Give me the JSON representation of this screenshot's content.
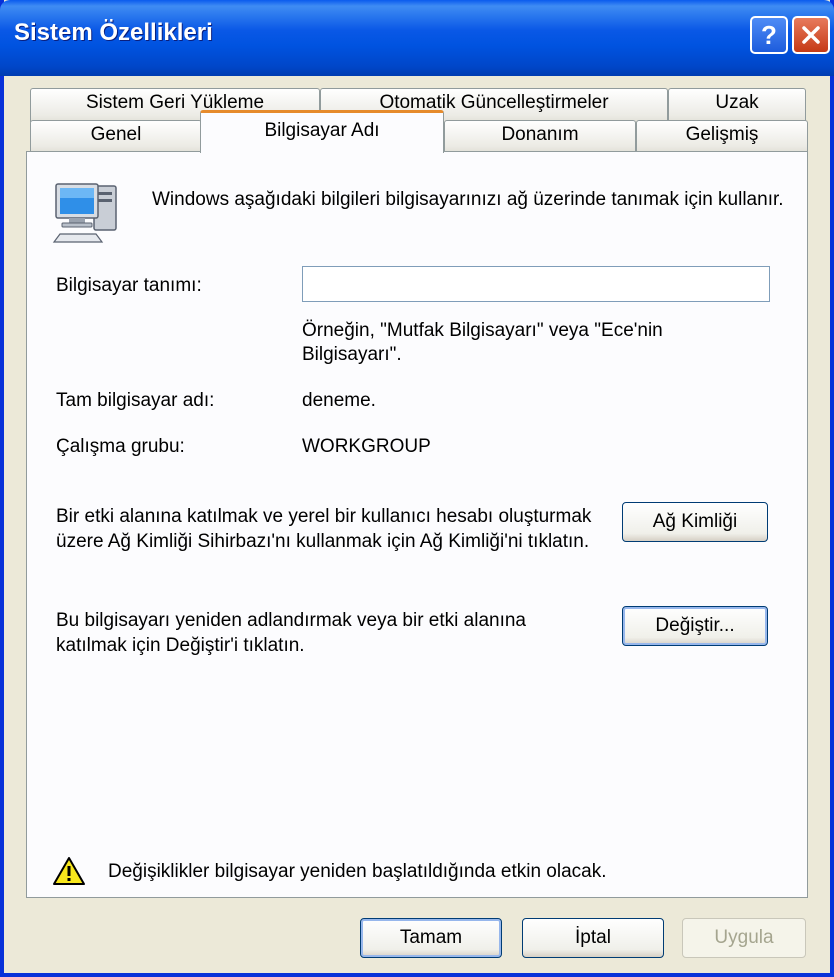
{
  "window": {
    "title": "Sistem Özellikleri",
    "help_label": "?",
    "colors": {
      "titlebar": "#0053E0",
      "face": "#ECE9D8",
      "active_tab_accent": "#E68B2C",
      "close": "#C53A16"
    }
  },
  "tabs_row1": [
    {
      "label": "Sistem Geri Yükleme"
    },
    {
      "label": "Otomatik Güncelleştirmeler"
    },
    {
      "label": "Uzak"
    }
  ],
  "tabs_row2": [
    {
      "label": "Genel"
    },
    {
      "label": "Bilgisayar Adı",
      "active": true
    },
    {
      "label": "Donanım"
    },
    {
      "label": "Gelişmiş"
    }
  ],
  "panel": {
    "intro_icon": "computer-icon",
    "intro": "Windows aşağıdaki bilgileri bilgisayarınızı ağ üzerinde tanımak için kullanır.",
    "description_label": "Bilgisayar tanımı:",
    "description_value": "",
    "example_line1": "Örneğin, \"Mutfak Bilgisayarı\" veya \"Ece'nin",
    "example_line2": "Bilgisayarı\".",
    "full_name_label": "Tam bilgisayar adı:",
    "full_name_value": "deneme.",
    "workgroup_label": "Çalışma grubu:",
    "workgroup_value": "WORKGROUP",
    "network_id_text": "Bir etki alanına katılmak ve yerel bir kullanıcı hesabı oluşturmak üzere Ağ Kimliği Sihirbazı'nı kullanmak için Ağ Kimliği'ni tıklatın.",
    "network_id_button": "Ağ Kimliği",
    "rename_text": "Bu bilgisayarı yeniden adlandırmak veya bir etki alanına katılmak için Değiştir'i tıklatın.",
    "change_button_pre": "De",
    "change_button_ul": "ğ",
    "change_button_post": "iştir...",
    "warning_icon": "warning-icon",
    "warning_text": "Değişiklikler bilgisayar yeniden  başlatıldığında etkin olacak."
  },
  "footer": {
    "ok_label": "Tamam",
    "cancel_label": "İptal",
    "apply_label": "Uygula"
  }
}
